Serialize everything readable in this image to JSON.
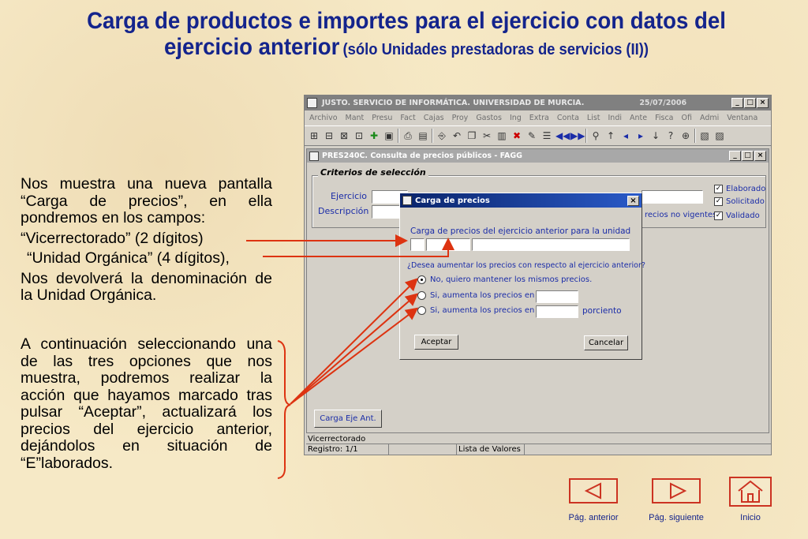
{
  "slide": {
    "title_line1": "Carga de productos e importes para el ejercicio con datos del",
    "title_line2": "ejercicio anterior",
    "title_sub": "(sólo Unidades prestadoras de servicios (II))",
    "para1": "Nos muestra una nueva pantalla “Carga de precios”, en ella pondremos en los campos:",
    "para2": "“Vicerrectorado” (2 dígitos)",
    "para3": "“Unidad Orgánica” (4 dígitos),",
    "para4": "Nos devolverá la denominación de la  Unidad Orgánica.",
    "para5": "A continuación seleccionando una de las tres opciones que nos muestra, podremos realizar la acción que hayamos marcado tras pulsar “Aceptar”, actualizará los precios del ejercicio anterior, dejándolos en situación de “E”laborados."
  },
  "app": {
    "title": "JUSTO. SERVICIO DE INFORMÁTICA. UNIVERSIDAD DE MURCIA.",
    "date": "25/07/2006",
    "menu": [
      "Archivo",
      "Mant",
      "Presu",
      "Fact",
      "Cajas",
      "Proy",
      "Gastos",
      "Ing",
      "Extra",
      "Conta",
      "List",
      "Indi",
      "Ante",
      "Fisca",
      "Ofi",
      "Admi",
      "Ventana"
    ],
    "child_title": "PRES240C. Consulta de precios públicos - FAGG",
    "group_title": "Criterios de selección",
    "label_ejercicio": "Ejercicio",
    "label_descripcion": "Descripción",
    "label_precios_no_vigentes": "recios no vigentes",
    "checks": [
      "Elaborado",
      "Solicitado",
      "Validado"
    ],
    "btn_carga": "Carga Eje Ant.",
    "status_row1": "Vicerrectorado",
    "status_registro": "Registro: 1/1",
    "status_lista": "Lista de Valores"
  },
  "dialog": {
    "title": "Carga de precios",
    "label_unidad": "Carga de precios del ejercicio anterior para la unidad",
    "question": "¿Desea aumentar los precios con respecto al ejercicio anterior?",
    "option1": "No, quiero mantener los mismos precios.",
    "option2": "Si, aumenta los precios en",
    "option3": "Si, aumenta los precios en un",
    "porciento": "porciento",
    "accept": "Aceptar",
    "cancel": "Cancelar"
  },
  "nav": {
    "prev": "Pág. anterior",
    "next": "Pág. siguiente",
    "home": "Inicio"
  },
  "colors": {
    "title_blue": "#14248c",
    "arrow_red": "#dd3311",
    "dialog_bar": "#0a246a"
  }
}
